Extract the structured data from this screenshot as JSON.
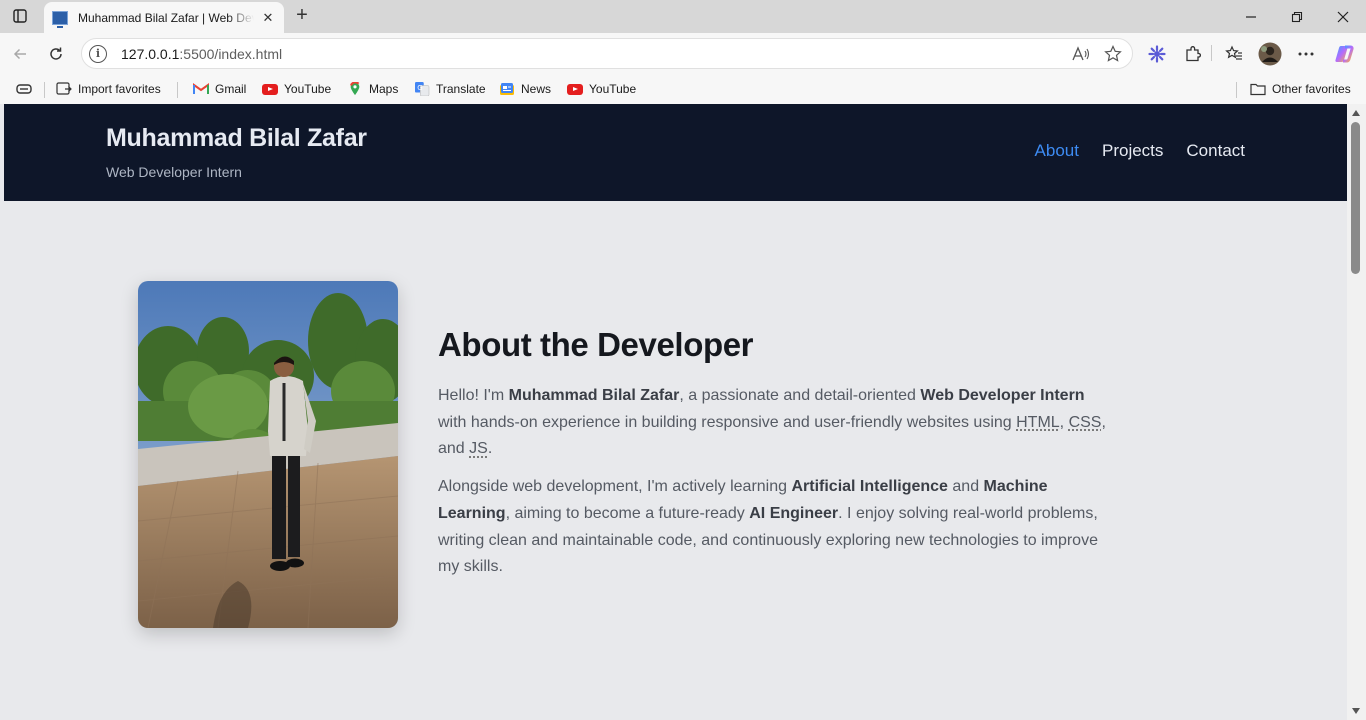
{
  "browser": {
    "tab_title": "Muhammad Bilal Zafar | Web Developer Intern",
    "tab_close": "✕",
    "new_tab": "+",
    "url_host": "127.0.0.1",
    "url_rest": ":5500/index.html",
    "window_controls": {
      "minimize": "—",
      "restore": "❐",
      "close": "✕"
    }
  },
  "favorites": {
    "import": "Import favorites",
    "items": [
      {
        "label": "Gmail",
        "icon": "gmail-icon"
      },
      {
        "label": "YouTube",
        "icon": "youtube-icon"
      },
      {
        "label": "Maps",
        "icon": "maps-icon"
      },
      {
        "label": "Translate",
        "icon": "translate-icon"
      },
      {
        "label": "News",
        "icon": "news-icon"
      },
      {
        "label": "YouTube",
        "icon": "youtube-icon"
      }
    ],
    "other": "Other favorites"
  },
  "site": {
    "name": "Muhammad Bilal Zafar",
    "subtitle": "Web Developer Intern",
    "nav": [
      {
        "label": "About",
        "active": true
      },
      {
        "label": "Projects",
        "active": false
      },
      {
        "label": "Contact",
        "active": false
      }
    ],
    "accent_color": "#3d8bf2",
    "header_color": "#0e1629"
  },
  "about": {
    "heading": "About the Developer",
    "p1": {
      "t1": "Hello! I'm ",
      "b1": "Muhammad Bilal Zafar",
      "t2": ", a passionate and detail-oriented ",
      "b2": "Web Developer Intern",
      "t3": " with hands-on experience in building responsive and user-friendly websites using ",
      "a1": "HTML",
      "t4": ", ",
      "a2": "CSS",
      "t5": ", and ",
      "a3": "JS",
      "t6": "."
    },
    "p2": {
      "t1": "Alongside web development, I'm actively learning ",
      "b1": "Artificial Intelligence",
      "t2": " and ",
      "b2": "Machine Learning",
      "t3": ", aiming to become a future-ready ",
      "b3": "AI Engineer",
      "t4": ". I enjoy solving real-world problems, writing clean and maintainable code, and continuously exploring new technologies to improve my skills."
    }
  }
}
